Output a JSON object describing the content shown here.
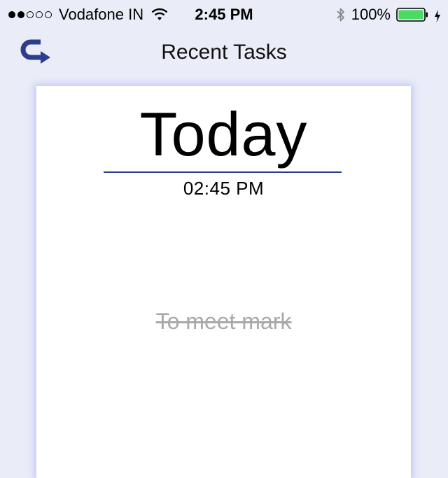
{
  "status_bar": {
    "carrier": "Vodafone IN",
    "time": "2:45 PM",
    "battery": "100%",
    "signal_strength": 2,
    "signal_max": 5
  },
  "nav": {
    "title": "Recent Tasks",
    "back_icon": "return-arrow-icon"
  },
  "card": {
    "day": "Today",
    "time": "02:45 PM",
    "tasks": [
      {
        "label": "To meet mark",
        "completed": true
      }
    ]
  },
  "colors": {
    "background": "#eaedf7",
    "accent": "#2b3d8f",
    "battery": "#4cd964",
    "completed_text": "#a9a9a9"
  }
}
